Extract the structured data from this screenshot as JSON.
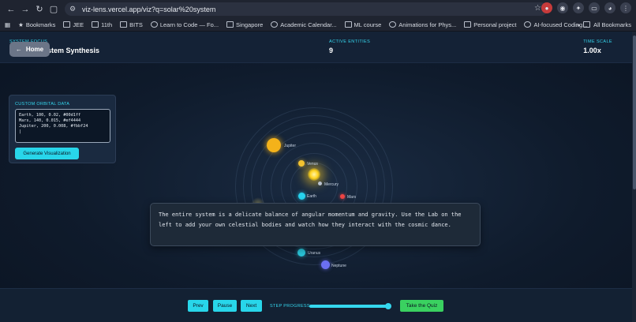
{
  "browser": {
    "url": "viz-lens.vercel.app/viz?q=solar%20system",
    "bookmarks": [
      "Bookmarks",
      "JEE",
      "11th",
      "BITS",
      "Learn to Code — Fo...",
      "Singapore",
      "Academic Calendar...",
      "ML course",
      "Animations for Phys...",
      "Personal project",
      "AI-focused Coding..."
    ],
    "all_bookmarks": "All Bookmarks",
    "badge_p": "P"
  },
  "header": {
    "system_focus_label": "SYSTEM FOCUS",
    "title": "stem Synthesis",
    "home_label": "Home",
    "active_entities_label": "ACTIVE ENTITIES",
    "active_entities_value": "9",
    "time_scale_label": "TIME SCALE",
    "time_scale_value": "1.00x"
  },
  "planets": [
    {
      "name": "Jupiter",
      "color": "#f4b21a"
    },
    {
      "name": "Venus",
      "color": "#f2c230"
    },
    {
      "name": "Mercury",
      "color": "#b9c2cf"
    },
    {
      "name": "Earth",
      "color": "#27d2ee"
    },
    {
      "name": "Mars",
      "color": "#ef4444"
    },
    {
      "name": "Uranus",
      "color": "#29c4d8"
    },
    {
      "name": "Neptune",
      "color": "#6b6ff2"
    }
  ],
  "panel": {
    "title": "CUSTOM ORBITAL DATA",
    "data_text": "Earth, 100, 0.02, #00d1ff\nMars, 140, 0.015, #ef4444\nJupiter, 200, 0.008, #fbbf24\n|",
    "generate_label": "Generate Visualization"
  },
  "dialog": {
    "text": "The entire system is a delicate balance of angular momentum and gravity. Use the Lab on the left to add your own celestial bodies and watch how they interact with the cosmic dance."
  },
  "footer": {
    "prev_label": "Prev",
    "pause_label": "Pause",
    "next_label": "Next",
    "step_progress_label": "STEP PROGRESS",
    "step_progress": 0.97,
    "quiz_label": "Take the Quiz"
  },
  "colors": {
    "accent": "#28d6ea",
    "quiz": "#3ad160",
    "background": "#0f1b2c"
  }
}
